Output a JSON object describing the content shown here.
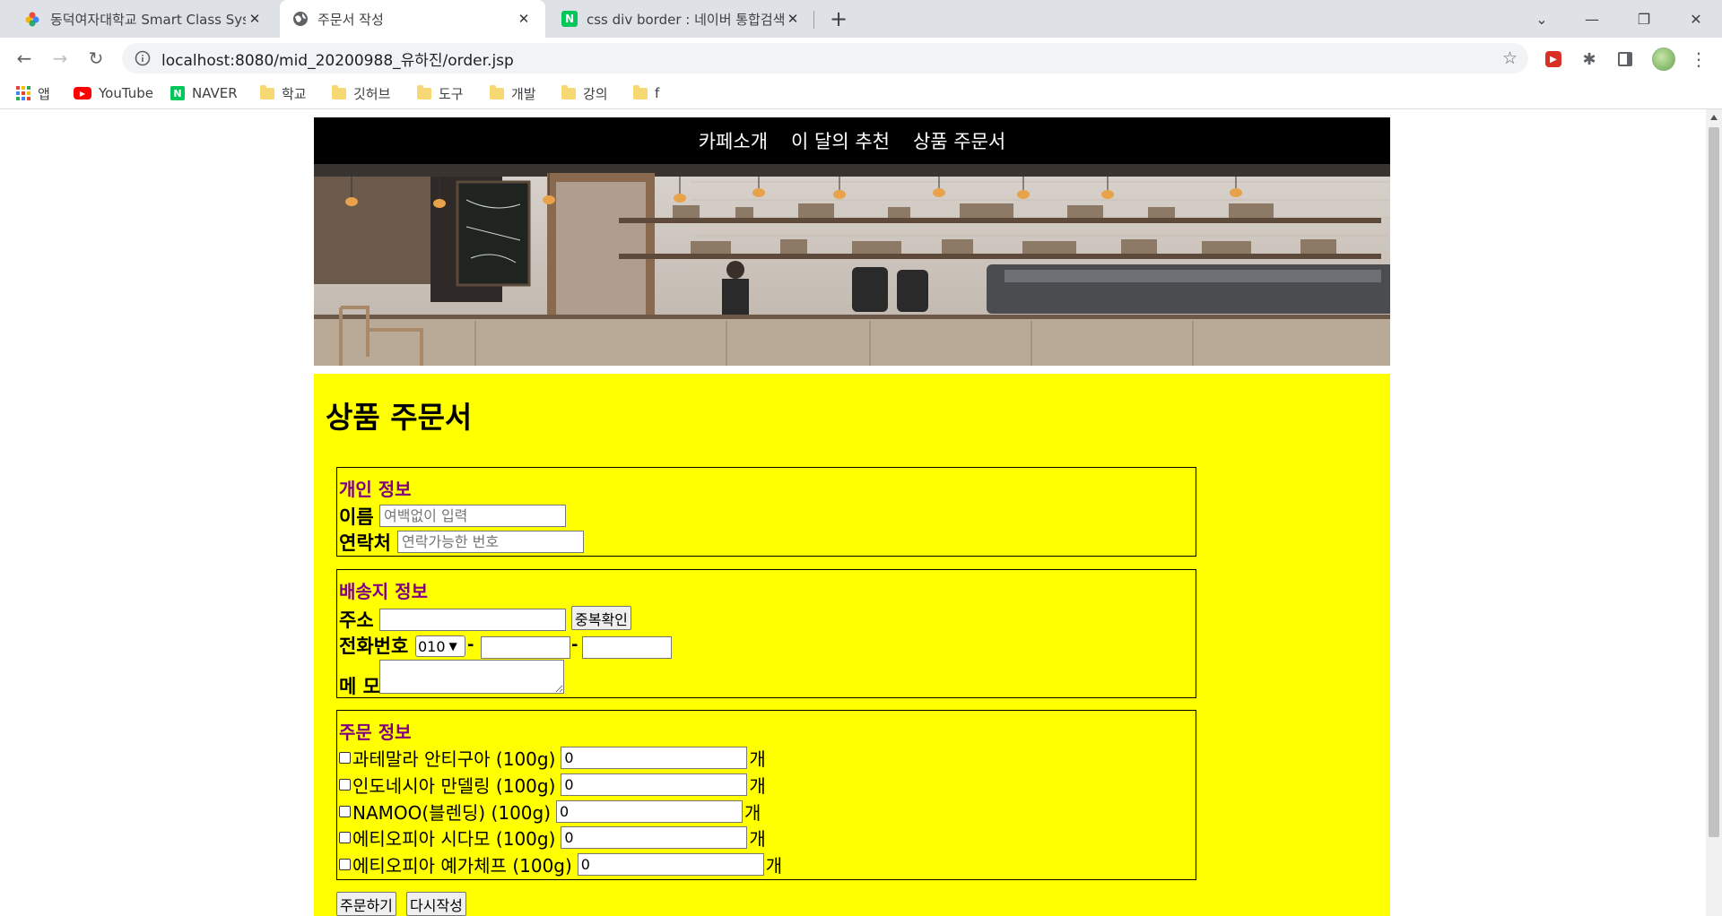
{
  "browser": {
    "tabs": [
      {
        "title": "동덕여자대학교 Smart Class Sys",
        "icon": "colorful-flower-icon",
        "active": false
      },
      {
        "title": "주문서 작성",
        "icon": "globe-icon",
        "active": true
      },
      {
        "title": "css div border : 네이버 통합검색",
        "icon": "naver-icon",
        "active": false
      }
    ],
    "url": "localhost:8080/mid_20200988_유하진/order.jsp",
    "bookmarks": [
      {
        "label": "앱",
        "icon": "apps-grid-icon"
      },
      {
        "label": "YouTube",
        "icon": "youtube-icon"
      },
      {
        "label": "NAVER",
        "icon": "naver-icon"
      },
      {
        "label": "학교",
        "icon": "folder-icon"
      },
      {
        "label": "깃허브",
        "icon": "folder-icon"
      },
      {
        "label": "도구",
        "icon": "folder-icon"
      },
      {
        "label": "개발",
        "icon": "folder-icon"
      },
      {
        "label": "강의",
        "icon": "folder-icon"
      },
      {
        "label": "f",
        "icon": "folder-icon"
      }
    ]
  },
  "page": {
    "nav": [
      "카페소개",
      "이 달의 추천",
      "상품 주문서"
    ],
    "title": "상품 주문서",
    "personal": {
      "legend": "개인 정보",
      "name_label": "이름",
      "name_placeholder": "여백없이 입력",
      "contact_label": "연락처",
      "contact_placeholder": "연락가능한 번호"
    },
    "shipping": {
      "legend": "배송지 정보",
      "address_label": "주소",
      "check_button": "중복확인",
      "phone_label": "전화번호",
      "phone_prefix": "010",
      "dash": "-",
      "memo_label": "메 모"
    },
    "order": {
      "legend": "주문 정보",
      "unit": "개",
      "items": [
        {
          "name": "과테말라 안티구아 (100g)",
          "qty": "0"
        },
        {
          "name": "인도네시아 만델링 (100g)",
          "qty": "0"
        },
        {
          "name": "NAMOO(블렌딩) (100g)",
          "qty": "0"
        },
        {
          "name": "에티오피아 시다모 (100g)",
          "qty": "0"
        },
        {
          "name": "에티오피아 예가체프 (100g)",
          "qty": "0"
        }
      ]
    },
    "buttons": {
      "submit": "주문하기",
      "reset": "다시작성"
    }
  }
}
